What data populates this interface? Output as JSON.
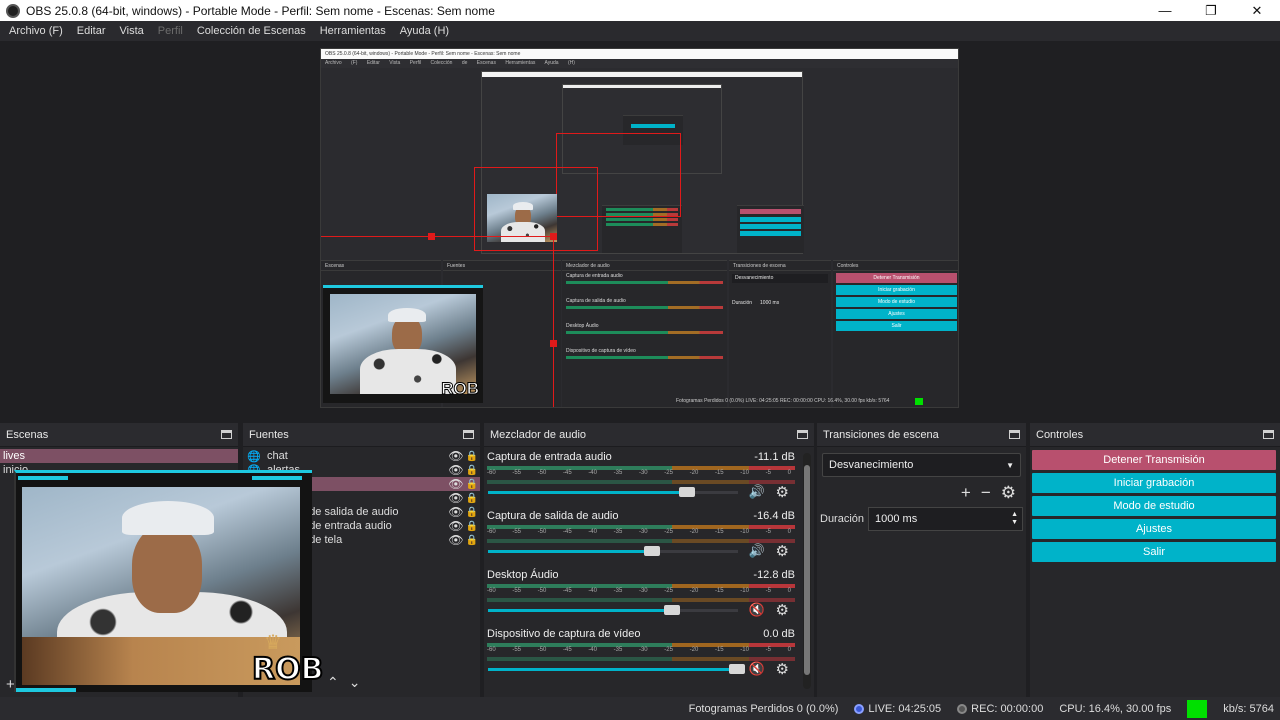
{
  "window": {
    "title": "OBS 25.0.8 (64-bit, windows) - Portable Mode - Perfil: Sem nome - Escenas: Sem nome",
    "minimize": "—",
    "maximize": "❐",
    "close": "✕"
  },
  "menu": {
    "items": [
      "Archivo (F)",
      "Editar",
      "Vista",
      "Perfil",
      "Colección de Escenas",
      "Herramientas",
      "Ayuda (H)"
    ]
  },
  "preview_nested": {
    "title": "OBS 25.0.8 (64-bit, windows) - Portable Mode - Perfil: Sem nome - Escenas: Sem nome",
    "menu": "Archivo (F) Editar Vista Perfil Colección de Escenas Herramientas Ayuda (H)",
    "scenes_head": "Escenas",
    "sources_head": "Fuentes",
    "mixer_head": "Mezclador de audio",
    "transitions_head": "Transiciones de escena",
    "controls_head": "Controles",
    "ch1": "Captura de entrada audio",
    "ch2": "Captura de salida de audio",
    "ch3": "Desktop Áudio",
    "ch4": "Dispositivo de captura de vídeo",
    "transition": "Desvanecimiento",
    "duration_label": "Duración",
    "duration": "1000 ms",
    "buttons": [
      "Detener Transmisión",
      "Iniciar grabación",
      "Modo de estudio",
      "Ajustes",
      "Salir"
    ],
    "status": "Fotogramas Perdidos 0 (0.0%)   LIVE: 04:25:05   REC: 00:00:00   CPU: 16.4%, 30.00 fps   kb/s: 5764",
    "logo": "ROB"
  },
  "scenes": {
    "header": "Escenas",
    "items": [
      "lives",
      "inicio"
    ]
  },
  "sources": {
    "header": "Fuentes",
    "items": [
      {
        "label": "chat",
        "icon": "globe-icon"
      },
      {
        "label": "alertas",
        "icon": "globe-icon"
      },
      {
        "label": "",
        "icon": ""
      },
      {
        "label": "",
        "icon": ""
      },
      {
        "label": "Captura de salida de audio",
        "icon": "speaker-icon"
      },
      {
        "label": "Captura de entrada audio",
        "icon": "mic-icon"
      },
      {
        "label": "Captura de tela",
        "icon": "monitor-icon"
      }
    ]
  },
  "mixer": {
    "header": "Mezclador de audio",
    "tick_labels": [
      "-60",
      "-55",
      "-50",
      "-45",
      "-40",
      "-35",
      "-30",
      "-25",
      "-20",
      "-15",
      "-10",
      "-5",
      "0"
    ],
    "channels": [
      {
        "name": "Captura de entrada audio",
        "db": "-11.1 dB",
        "fader_pct": 0.8,
        "muted": false
      },
      {
        "name": "Captura de salida de audio",
        "db": "-16.4 dB",
        "fader_pct": 0.66,
        "muted": false
      },
      {
        "name": "Desktop Áudio",
        "db": "-12.8 dB",
        "fader_pct": 0.74,
        "muted": true
      },
      {
        "name": "Dispositivo de captura de vídeo",
        "db": "0.0 dB",
        "fader_pct": 1.0,
        "muted": true
      }
    ]
  },
  "transitions": {
    "header": "Transiciones de escena",
    "selected": "Desvanecimiento",
    "duration_label": "Duración",
    "duration_value": "1000 ms"
  },
  "controls": {
    "header": "Controles",
    "stop_stream": "Detener Transmisión",
    "start_recording": "Iniciar grabación",
    "studio_mode": "Modo de estudio",
    "settings": "Ajustes",
    "exit": "Salir"
  },
  "overlay": {
    "logo": "ROB"
  },
  "status": {
    "dropped_frames": "Fotogramas Perdidos 0 (0.0%)",
    "live": "LIVE: 04:25:05",
    "rec": "REC: 00:00:00",
    "cpu": "CPU: 16.4%, 30.00 fps",
    "kbps": "kb/s: 5764"
  },
  "colors": {
    "accent": "#00b3c9",
    "stop": "#b8506e",
    "selection": "#e01a1a",
    "ok": "#00e000"
  }
}
